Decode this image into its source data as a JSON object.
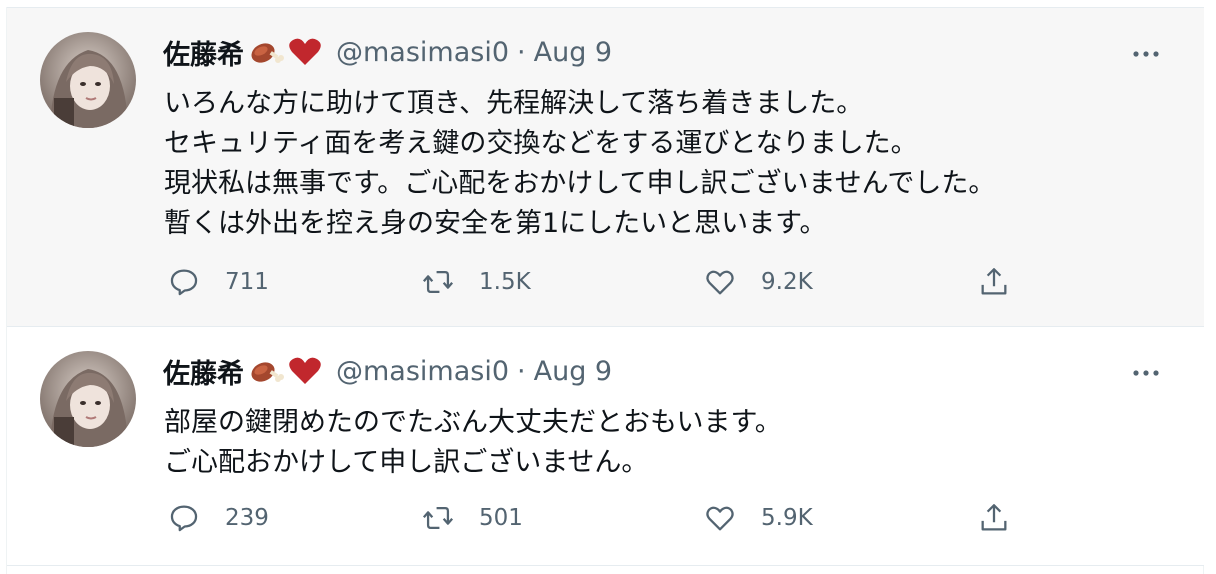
{
  "tweets": [
    {
      "author": {
        "name": "佐藤希",
        "handle": "@masimasi0",
        "emoji": [
          "meat-on-bone-icon",
          "red-heart-icon"
        ]
      },
      "date": "Aug 9",
      "separator": "·",
      "lines": [
        "いろんな方に助けて頂き、先程解決して落ち着きました。",
        "セキュリティ面を考え鍵の交換などをする運びとなりました。",
        "現状私は無事です。ご心配をおかけして申し訳ございませんでした。",
        "暫くは外出を控え身の安全を第1にしたいと思います。"
      ],
      "counts": {
        "replies": "711",
        "retweets": "1.5K",
        "likes": "9.2K"
      }
    },
    {
      "author": {
        "name": "佐藤希",
        "handle": "@masimasi0",
        "emoji": [
          "meat-on-bone-icon",
          "red-heart-icon"
        ]
      },
      "date": "Aug 9",
      "separator": "·",
      "lines": [
        "部屋の鍵閉めたのでたぶん大丈夫だとおもいます。",
        "ご心配おかけして申し訳ございません。"
      ],
      "counts": {
        "replies": "239",
        "retweets": "501",
        "likes": "5.9K"
      }
    }
  ],
  "colors": {
    "text": "#0f1419",
    "secondary": "#536471",
    "heart": "#c1272d",
    "hover_bg": "#f7f7f7",
    "border": "#e6ecf0"
  }
}
